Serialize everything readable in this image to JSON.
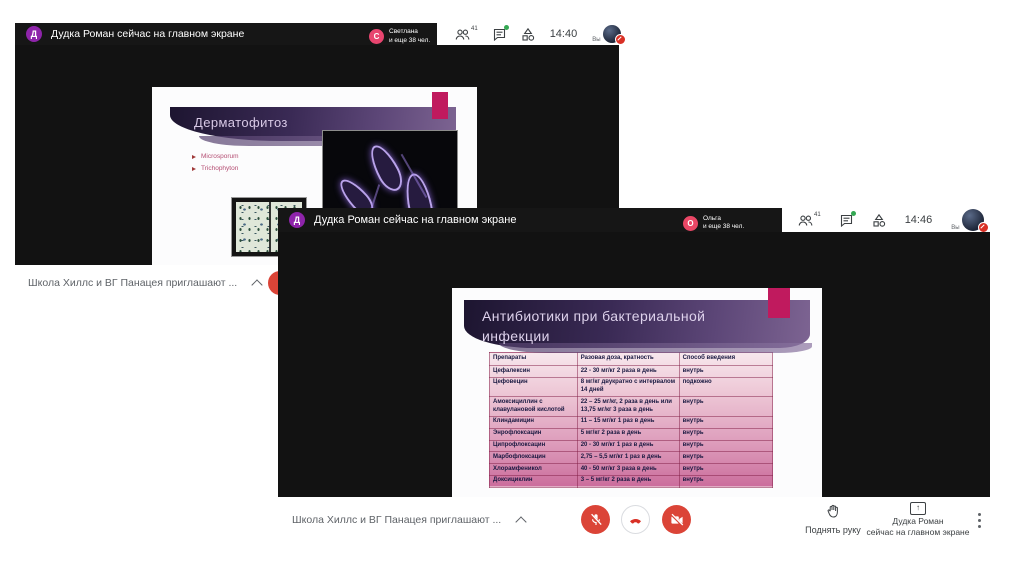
{
  "colors": {
    "accent_magenta": "#c01a5e",
    "meet_red": "#db4437",
    "chat_new_green": "#34a853",
    "presenter_avatar_purple": "#8e24aa",
    "banner_purple_dark": "#1d1530",
    "banner_purple_light": "#7d6492",
    "table_pink_top": "#f7e7ed",
    "table_pink_bottom": "#cb6d9c"
  },
  "windows": [
    {
      "header": {
        "presenter_initial": "Д",
        "status_text": "Дудка Роман сейчас на главном экране",
        "participant_initial": "С",
        "participant_name": "Светлана",
        "participant_more": "и еще 38 чел.",
        "participants_count": "41",
        "time": "14:40",
        "you_label": "Вы"
      },
      "slide": {
        "title": "Дерматофитоз",
        "bullets": [
          "Microsporum",
          "Trichophyton"
        ]
      },
      "footer": {
        "banner_text": "Школа Хиллс и ВГ Панацея приглашают ..."
      }
    },
    {
      "header": {
        "presenter_initial": "Д",
        "status_text": "Дудка Роман сейчас на главном экране",
        "participant_initial": "О",
        "participant_name": "Ольга",
        "participant_more": "и еще 38 чел.",
        "participants_count": "41",
        "time": "14:46",
        "you_label": "Вы"
      },
      "slide": {
        "title_line1": "Антибиотики при бактериальной",
        "title_line2": "инфекции",
        "table": {
          "headers": [
            "Препараты",
            "Разовая доза, кратность",
            "Способ введения"
          ],
          "rows": [
            [
              "Цефалексин",
              "22 - 30 мг/кг 2 раза в день",
              "внутрь"
            ],
            [
              "Цефовецин",
              "8 мг/кг двукратно с интервалом 14 дней",
              "подкожно"
            ],
            [
              "Амоксициллин с клавулановой кислотой",
              "22 – 25 мг/кг, 2 раза в день или 13,75 мг/кг 3 раза в день",
              "внутрь"
            ],
            [
              "Клиндамицин",
              "11 – 15 мг/кг 1 раз в день",
              "внутрь"
            ],
            [
              "Энрофлоксацин",
              "5 мг/кг 2 раза в день",
              "внутрь"
            ],
            [
              "Ципрофлоксацин",
              "20 - 30 мг/кг 1 раз в день",
              "внутрь"
            ],
            [
              "Марбофлоксацин",
              "2,75 – 5,5 мг/кг 1 раз в день",
              "внутрь"
            ],
            [
              "Хлорамфеникол",
              "40 - 50 мг/кг 3 раза в день",
              "внутрь"
            ],
            [
              "Доксициклин",
              "3 – 5 мг/кг 2 раза в день",
              "внутрь"
            ]
          ]
        }
      },
      "footer": {
        "banner_text": "Школа Хиллс и ВГ Панацея приглашают ...",
        "raise_hand_label": "Поднять руку",
        "present_line1": "Дудка Роман",
        "present_line2": "сейчас на главном экране"
      }
    }
  ]
}
